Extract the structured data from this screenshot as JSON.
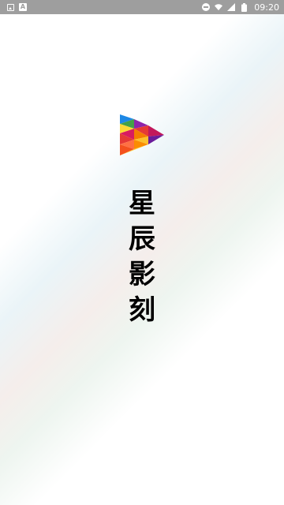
{
  "status_bar": {
    "left_icons": [
      "image-icon",
      "a-icon"
    ],
    "right_icons": [
      "dnd-icon",
      "wifi-icon",
      "signal-icon",
      "battery-icon"
    ],
    "time": "09:20",
    "background": "#9e9e9e"
  },
  "splash": {
    "logo_icon": "play-logo-icon",
    "title_chars": [
      "星",
      "辰",
      "影",
      "刻"
    ]
  }
}
